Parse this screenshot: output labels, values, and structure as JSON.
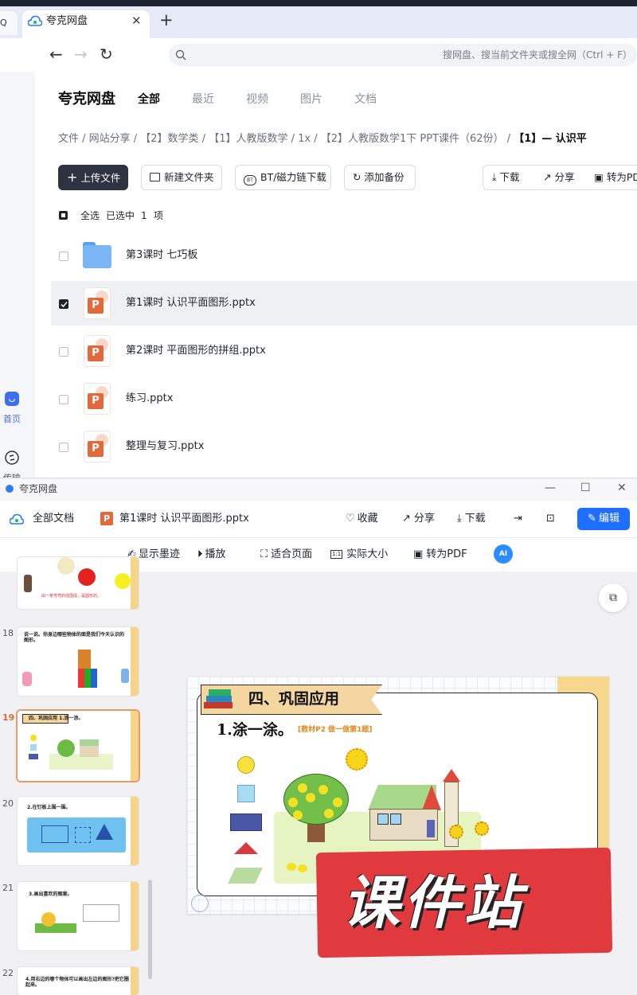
{
  "browser": {
    "tab_ghost_label": "Q",
    "tab_title": "夸克网盘",
    "tab_close": "✕",
    "new_tab": "+",
    "address_placeholder": "搜网盘、搜当前文件夹或搜全网（Ctrl + F）"
  },
  "rail": {
    "home_label": "首页",
    "transfer_label": "传输"
  },
  "drive": {
    "brand": "夸克网盘",
    "tabs": [
      {
        "label": "全部",
        "active": true
      },
      {
        "label": "最近"
      },
      {
        "label": "视频"
      },
      {
        "label": "图片"
      },
      {
        "label": "文档"
      }
    ],
    "breadcrumb": {
      "path": "文件 / 网站分享 / 【2】数学类 / 【1】人教版数学 / 1x / 【2】人教版数学1下 PPT课件（62份） / ",
      "current": "【1】— 认识平"
    },
    "actions": {
      "upload": "上传文件",
      "new_folder": "新建文件夹",
      "bt_download": "BT/磁力链下载",
      "backup": "添加备份",
      "download": "下载",
      "share": "分享",
      "to_pdf": "转为PDF"
    },
    "selection": {
      "select_all": "全选",
      "selected_text": "已选中",
      "count": "1",
      "unit": "项"
    },
    "files": [
      {
        "name": "第3课时 七巧板",
        "type": "folder",
        "checked": false
      },
      {
        "name": "第1课时 认识平面图形.pptx",
        "type": "pptx",
        "checked": true
      },
      {
        "name": "第2课时 平面图形的拼组.pptx",
        "type": "pptx",
        "checked": false
      },
      {
        "name": "练习.pptx",
        "type": "pptx",
        "checked": false
      },
      {
        "name": "整理与复习.pptx",
        "type": "pptx",
        "checked": false
      }
    ]
  },
  "viewer": {
    "window_title": "夸克网盘",
    "all_docs": "全部文档",
    "file_name": "第1课时 认识平面图形.pptx",
    "favorite": "收藏",
    "share": "分享",
    "download": "下载",
    "edit": "编辑",
    "tools": {
      "ink": "显示墨迹",
      "play": "播放",
      "fit_page": "适合页面",
      "actual_size": "实际大小",
      "to_pdf": "转为PDF",
      "ai": "AI"
    },
    "thumbnails": [
      {
        "num": "",
        "head": "由一条弯弯的线围成，是圆形的。"
      },
      {
        "num": "18",
        "head": "说一说。你身边哪些物体的面是我们今天认识的图形。"
      },
      {
        "num": "19",
        "head": "四、巩固应用  1.涂一涂。",
        "active": true
      },
      {
        "num": "20",
        "head": "2.在钉板上围一围。"
      },
      {
        "num": "21",
        "head": "3.画出喜欢的图案。"
      },
      {
        "num": "22",
        "head": "4.用右边的哪个物体可以画出左边的图形?把它圈起来。"
      }
    ],
    "slide": {
      "banner": "四、巩固应用",
      "task": "1.涂一涂。",
      "task_note": "[教材P2 做一做第1题]"
    },
    "watermark": "课件站"
  }
}
